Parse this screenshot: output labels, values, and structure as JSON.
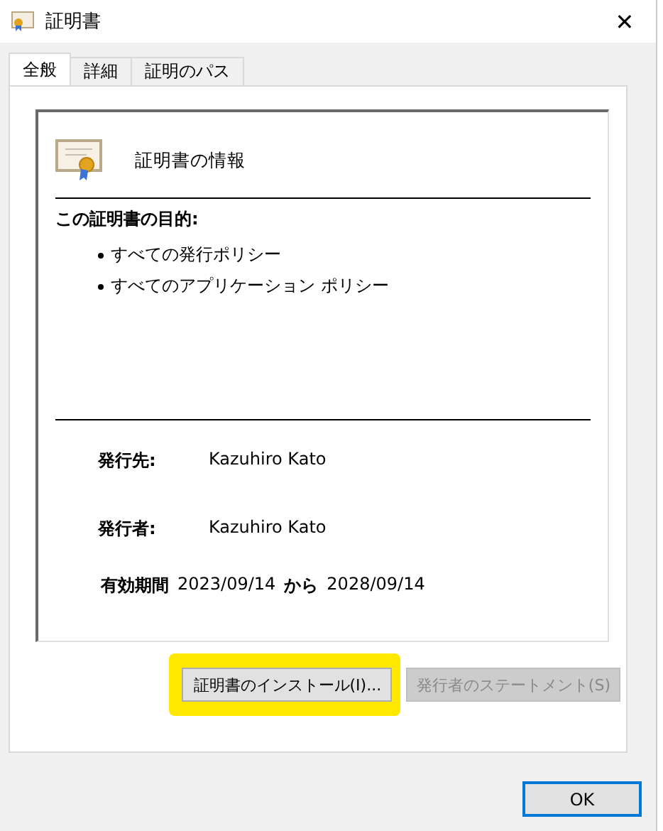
{
  "window": {
    "title": "証明書",
    "close": "✕"
  },
  "tabs": [
    {
      "label": "全般",
      "selected": true
    },
    {
      "label": "詳細",
      "selected": false
    },
    {
      "label": "証明のパス",
      "selected": false
    }
  ],
  "info": {
    "heading": "証明書の情報",
    "purpose_title": "この証明書の目的:",
    "purposes": [
      "すべての発行ポリシー",
      "すべてのアプリケーション ポリシー"
    ],
    "issued_to_label": "発行先:",
    "issued_to": "Kazuhiro Kato",
    "issued_by_label": "発行者:",
    "issued_by": "Kazuhiro Kato",
    "validity_label": "有効期間",
    "valid_from": "2023/09/14",
    "from_word": "から",
    "valid_to": "2028/09/14"
  },
  "buttons": [
    {
      "label": "証明書のインストール(I)...",
      "disabled": false,
      "highlighted": true
    },
    {
      "label": "発行者のステートメント(S)",
      "disabled": true,
      "highlighted": false
    }
  ],
  "ok": "OK"
}
